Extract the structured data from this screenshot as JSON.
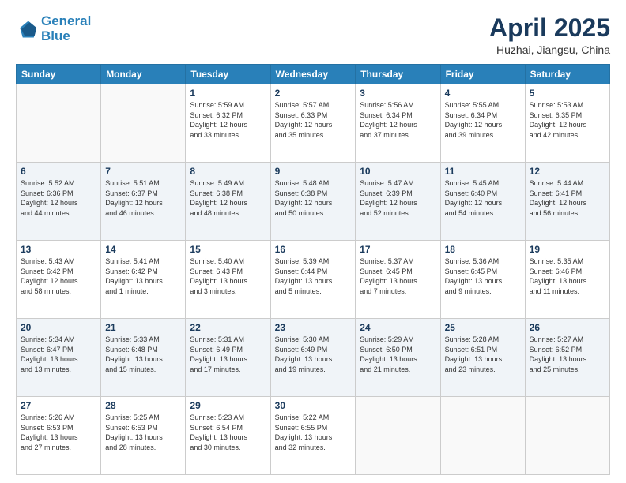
{
  "header": {
    "logo_line1": "General",
    "logo_line2": "Blue",
    "month_title": "April 2025",
    "location": "Huzhai, Jiangsu, China"
  },
  "weekdays": [
    "Sunday",
    "Monday",
    "Tuesday",
    "Wednesday",
    "Thursday",
    "Friday",
    "Saturday"
  ],
  "weeks": [
    [
      {
        "day": "",
        "info": ""
      },
      {
        "day": "",
        "info": ""
      },
      {
        "day": "1",
        "info": "Sunrise: 5:59 AM\nSunset: 6:32 PM\nDaylight: 12 hours\nand 33 minutes."
      },
      {
        "day": "2",
        "info": "Sunrise: 5:57 AM\nSunset: 6:33 PM\nDaylight: 12 hours\nand 35 minutes."
      },
      {
        "day": "3",
        "info": "Sunrise: 5:56 AM\nSunset: 6:34 PM\nDaylight: 12 hours\nand 37 minutes."
      },
      {
        "day": "4",
        "info": "Sunrise: 5:55 AM\nSunset: 6:34 PM\nDaylight: 12 hours\nand 39 minutes."
      },
      {
        "day": "5",
        "info": "Sunrise: 5:53 AM\nSunset: 6:35 PM\nDaylight: 12 hours\nand 42 minutes."
      }
    ],
    [
      {
        "day": "6",
        "info": "Sunrise: 5:52 AM\nSunset: 6:36 PM\nDaylight: 12 hours\nand 44 minutes."
      },
      {
        "day": "7",
        "info": "Sunrise: 5:51 AM\nSunset: 6:37 PM\nDaylight: 12 hours\nand 46 minutes."
      },
      {
        "day": "8",
        "info": "Sunrise: 5:49 AM\nSunset: 6:38 PM\nDaylight: 12 hours\nand 48 minutes."
      },
      {
        "day": "9",
        "info": "Sunrise: 5:48 AM\nSunset: 6:38 PM\nDaylight: 12 hours\nand 50 minutes."
      },
      {
        "day": "10",
        "info": "Sunrise: 5:47 AM\nSunset: 6:39 PM\nDaylight: 12 hours\nand 52 minutes."
      },
      {
        "day": "11",
        "info": "Sunrise: 5:45 AM\nSunset: 6:40 PM\nDaylight: 12 hours\nand 54 minutes."
      },
      {
        "day": "12",
        "info": "Sunrise: 5:44 AM\nSunset: 6:41 PM\nDaylight: 12 hours\nand 56 minutes."
      }
    ],
    [
      {
        "day": "13",
        "info": "Sunrise: 5:43 AM\nSunset: 6:42 PM\nDaylight: 12 hours\nand 58 minutes."
      },
      {
        "day": "14",
        "info": "Sunrise: 5:41 AM\nSunset: 6:42 PM\nDaylight: 13 hours\nand 1 minute."
      },
      {
        "day": "15",
        "info": "Sunrise: 5:40 AM\nSunset: 6:43 PM\nDaylight: 13 hours\nand 3 minutes."
      },
      {
        "day": "16",
        "info": "Sunrise: 5:39 AM\nSunset: 6:44 PM\nDaylight: 13 hours\nand 5 minutes."
      },
      {
        "day": "17",
        "info": "Sunrise: 5:37 AM\nSunset: 6:45 PM\nDaylight: 13 hours\nand 7 minutes."
      },
      {
        "day": "18",
        "info": "Sunrise: 5:36 AM\nSunset: 6:45 PM\nDaylight: 13 hours\nand 9 minutes."
      },
      {
        "day": "19",
        "info": "Sunrise: 5:35 AM\nSunset: 6:46 PM\nDaylight: 13 hours\nand 11 minutes."
      }
    ],
    [
      {
        "day": "20",
        "info": "Sunrise: 5:34 AM\nSunset: 6:47 PM\nDaylight: 13 hours\nand 13 minutes."
      },
      {
        "day": "21",
        "info": "Sunrise: 5:33 AM\nSunset: 6:48 PM\nDaylight: 13 hours\nand 15 minutes."
      },
      {
        "day": "22",
        "info": "Sunrise: 5:31 AM\nSunset: 6:49 PM\nDaylight: 13 hours\nand 17 minutes."
      },
      {
        "day": "23",
        "info": "Sunrise: 5:30 AM\nSunset: 6:49 PM\nDaylight: 13 hours\nand 19 minutes."
      },
      {
        "day": "24",
        "info": "Sunrise: 5:29 AM\nSunset: 6:50 PM\nDaylight: 13 hours\nand 21 minutes."
      },
      {
        "day": "25",
        "info": "Sunrise: 5:28 AM\nSunset: 6:51 PM\nDaylight: 13 hours\nand 23 minutes."
      },
      {
        "day": "26",
        "info": "Sunrise: 5:27 AM\nSunset: 6:52 PM\nDaylight: 13 hours\nand 25 minutes."
      }
    ],
    [
      {
        "day": "27",
        "info": "Sunrise: 5:26 AM\nSunset: 6:53 PM\nDaylight: 13 hours\nand 27 minutes."
      },
      {
        "day": "28",
        "info": "Sunrise: 5:25 AM\nSunset: 6:53 PM\nDaylight: 13 hours\nand 28 minutes."
      },
      {
        "day": "29",
        "info": "Sunrise: 5:23 AM\nSunset: 6:54 PM\nDaylight: 13 hours\nand 30 minutes."
      },
      {
        "day": "30",
        "info": "Sunrise: 5:22 AM\nSunset: 6:55 PM\nDaylight: 13 hours\nand 32 minutes."
      },
      {
        "day": "",
        "info": ""
      },
      {
        "day": "",
        "info": ""
      },
      {
        "day": "",
        "info": ""
      }
    ]
  ]
}
